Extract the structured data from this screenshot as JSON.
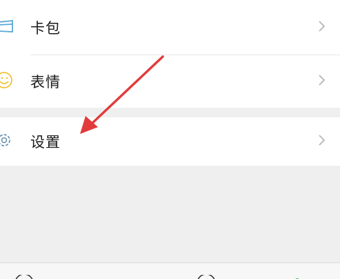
{
  "menu": {
    "wallet": {
      "label": "卡包",
      "icon": "card-wallet-icon"
    },
    "sticker": {
      "label": "表情",
      "icon": "smiley-icon"
    },
    "settings": {
      "label": "设置",
      "icon": "gear-icon"
    }
  },
  "tab_bar": {
    "icons": [
      "chat-icon",
      "contacts-icon",
      "discover-icon",
      "me-icon"
    ],
    "active_dot_color": "#2bc45a"
  },
  "annotation": {
    "icon": "red-arrow-pointer",
    "color": "#e23b3b"
  },
  "colors": {
    "wallet_icon": "#5aa7d8",
    "smiley_icon": "#f0c330",
    "gear_icon": "#6a93b0",
    "chevron": "#b5b5b5"
  }
}
